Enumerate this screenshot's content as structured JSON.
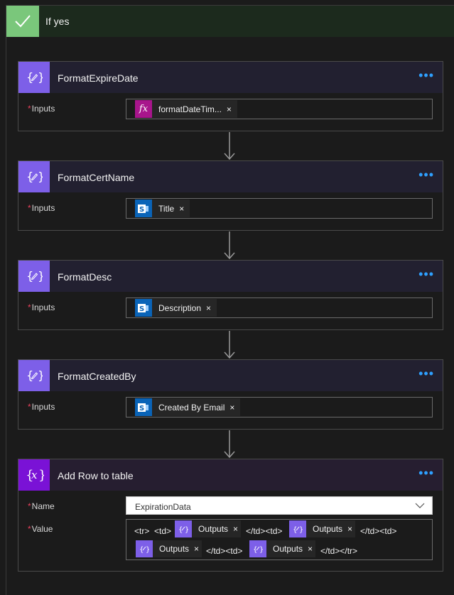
{
  "branch": {
    "title": "If yes"
  },
  "cards": [
    {
      "title": "FormatExpireDate",
      "field_label": "Inputs",
      "token": {
        "type": "expression",
        "label": "formatDateTim..."
      }
    },
    {
      "title": "FormatCertName",
      "field_label": "Inputs",
      "token": {
        "type": "sharepoint",
        "label": "Title"
      }
    },
    {
      "title": "FormatDesc",
      "field_label": "Inputs",
      "token": {
        "type": "sharepoint",
        "label": "Description"
      }
    },
    {
      "title": "FormatCreatedBy",
      "field_label": "Inputs",
      "token": {
        "type": "sharepoint",
        "label": "Created By Email"
      }
    }
  ],
  "add_row": {
    "title": "Add Row to table",
    "name_label": "Name",
    "name_value": "ExpirationData",
    "value_label": "Value",
    "value_parts": {
      "tr_open": "<tr>",
      "td_open_1": "<td>",
      "out_1": "Outputs",
      "close_open_1": "</td><td>",
      "out_2": "Outputs",
      "close_open_2": "</td><td>",
      "out_3": "Outputs",
      "close_open_3": "</td><td>",
      "out_4": "Outputs",
      "close_end": "</td></tr>"
    }
  },
  "required_marker": "*",
  "more_label": "•••",
  "remove_label": "×",
  "fx_label": "fx",
  "colors": {
    "accent": "#2ea0ff",
    "compose": "#7d5fe8",
    "variable": "#7a12d6",
    "expression": "#a8158c",
    "sharepoint": "#0a64b8",
    "success": "#7ac77b",
    "required": "#e8405c"
  }
}
